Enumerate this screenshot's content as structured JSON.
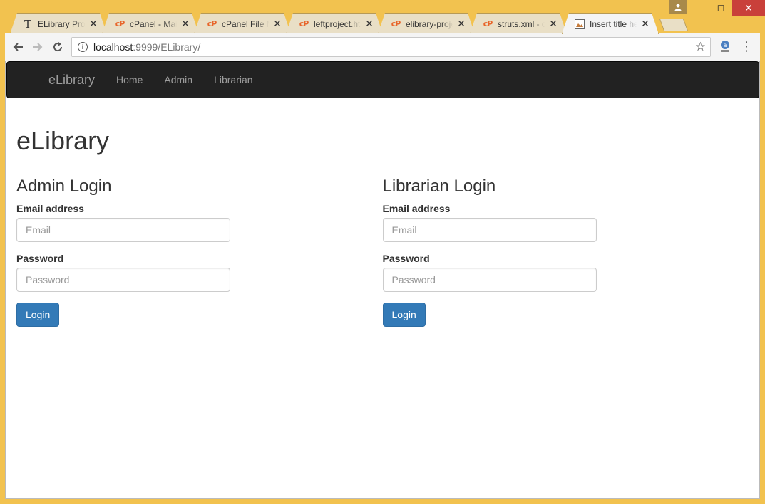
{
  "browser": {
    "tabs": [
      {
        "title": "ELibrary Project",
        "icon": "text-doc-icon",
        "active": false
      },
      {
        "title": "cPanel - Main",
        "icon": "cpanel-icon",
        "active": false
      },
      {
        "title": "cPanel File Manager",
        "icon": "cpanel-icon",
        "active": false
      },
      {
        "title": "leftproject.html",
        "icon": "cpanel-icon",
        "active": false
      },
      {
        "title": "elibrary-project",
        "icon": "cpanel-icon",
        "active": false
      },
      {
        "title": "struts.xml - cPanel",
        "icon": "cpanel-icon",
        "active": false
      },
      {
        "title": "Insert title here",
        "icon": "image-icon",
        "active": true
      }
    ],
    "url_host": "localhost",
    "url_rest": ":9999/ELibrary/"
  },
  "navbar": {
    "brand": "eLibrary",
    "links": [
      "Home",
      "Admin",
      "Librarian"
    ]
  },
  "page": {
    "title": "eLibrary",
    "admin": {
      "heading": "Admin Login",
      "email_label": "Email address",
      "email_placeholder": "Email",
      "password_label": "Password",
      "password_placeholder": "Password",
      "button": "Login"
    },
    "librarian": {
      "heading": "Librarian Login",
      "email_label": "Email address",
      "email_placeholder": "Email",
      "password_label": "Password",
      "password_placeholder": "Password",
      "button": "Login"
    }
  },
  "colors": {
    "window_frame": "#f2c24f",
    "navbar_bg": "#222222",
    "primary_button": "#337ab7"
  }
}
